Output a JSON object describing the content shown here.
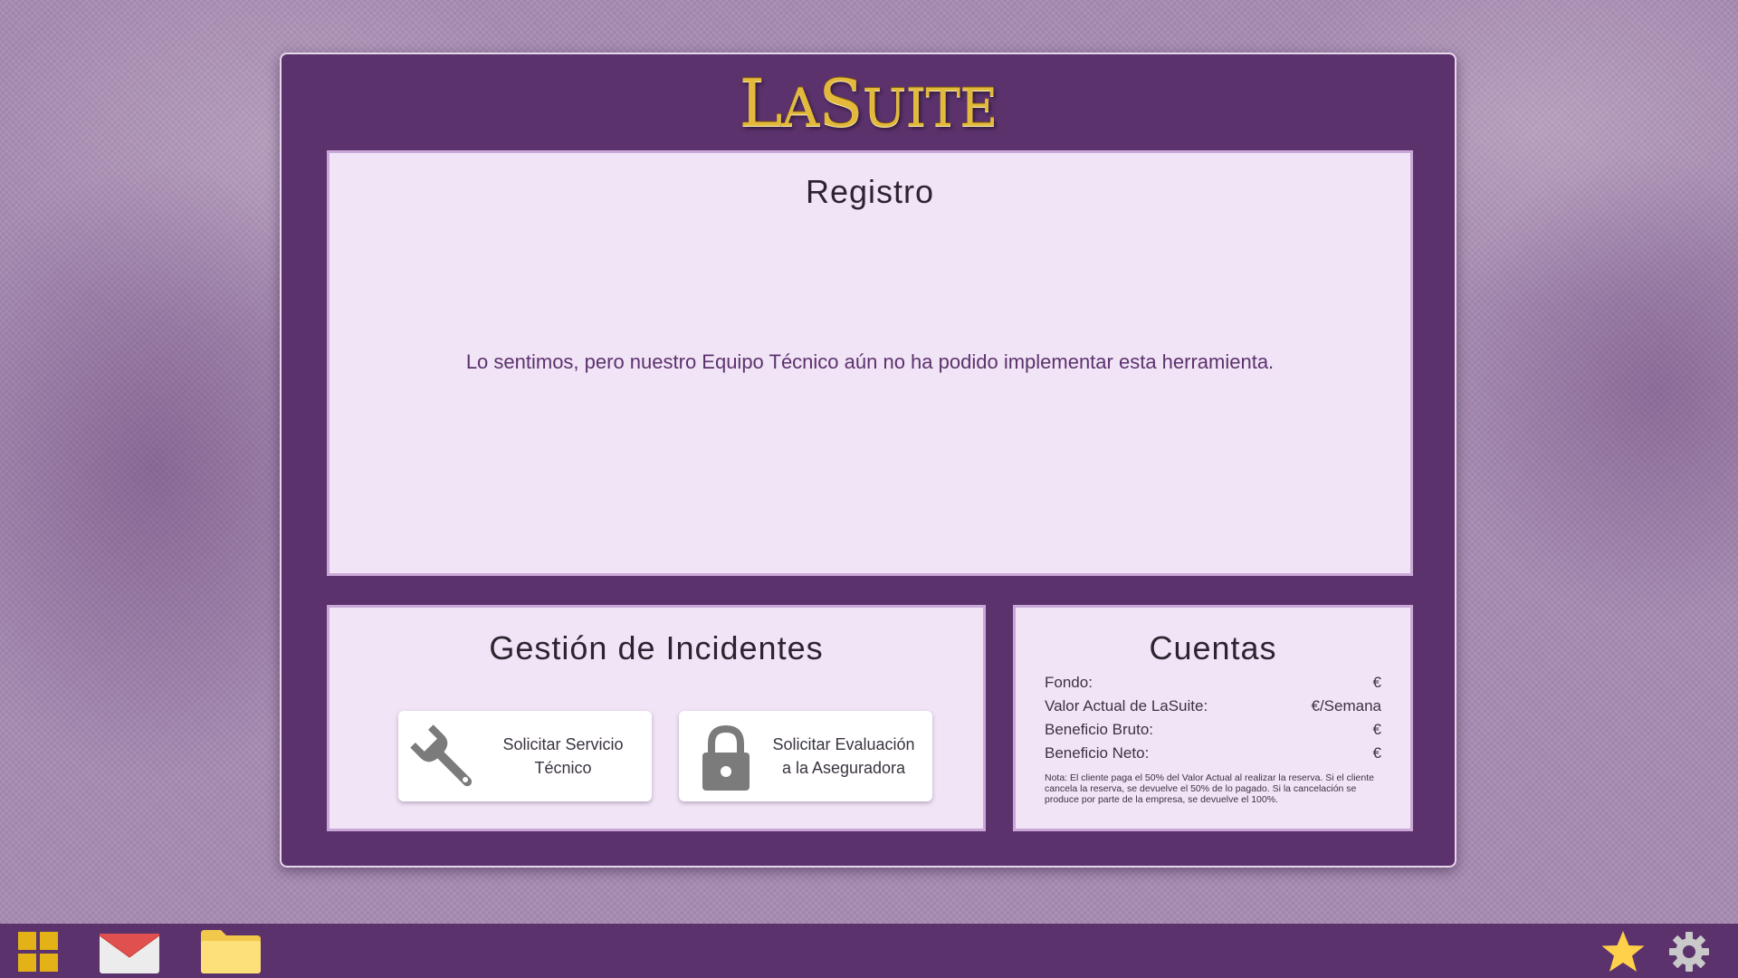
{
  "logo": {
    "first": "L",
    "first_small": "A",
    "second": "S",
    "second_small": "UITE"
  },
  "registro": {
    "title": "Registro",
    "message": "Lo sentimos, pero nuestro Equipo Técnico aún no ha podido implementar esta herramienta."
  },
  "incidentes": {
    "title": "Gestión de Incidentes",
    "buttons": [
      {
        "label": "Solicitar Servicio\nTécnico",
        "icon": "wrench-icon"
      },
      {
        "label": "Solicitar Evaluación\na la Aseguradora",
        "icon": "lock-icon"
      }
    ]
  },
  "cuentas": {
    "title": "Cuentas",
    "rows": [
      {
        "label": "Fondo:",
        "value": "€"
      },
      {
        "label": "Valor Actual de LaSuite:",
        "value": "€/Semana"
      },
      {
        "label": "Beneficio Bruto:",
        "value": "€"
      },
      {
        "label": "Beneficio Neto:",
        "value": "€"
      }
    ],
    "note": "Nota: El cliente paga el 50% del Valor Actual al realizar la reserva. Si el cliente cancela la reserva, se devuelve el 50% de lo pagado. Si la cancelación se produce por parte de la empresa, se devuelve el 100%."
  },
  "taskbar": {
    "left_icons": [
      "apps-grid-icon",
      "mail-icon",
      "folder-icon"
    ],
    "right_icons": [
      "star-icon",
      "gear-icon"
    ]
  },
  "colors": {
    "window": "#5c326d",
    "panel": "#f1e4f6",
    "panel_border": "#c9a7d6",
    "logo_gold": "#e2b93a",
    "taskbar": "#5c326d"
  }
}
